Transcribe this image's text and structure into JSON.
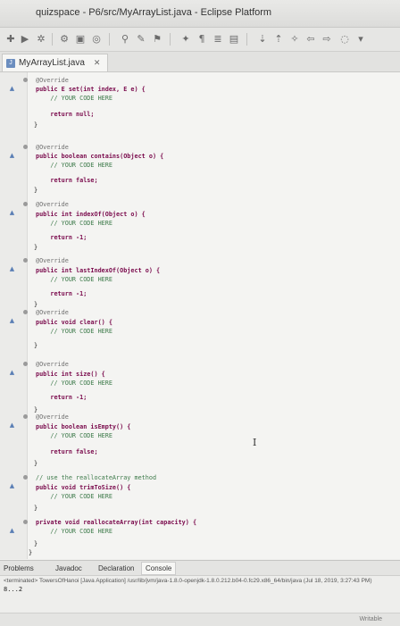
{
  "window": {
    "title": "quizspace - P6/src/MyArrayList.java - Eclipse Platform"
  },
  "toolbar": {
    "icons": [
      "new-icon",
      "run-icon",
      "debug-icon",
      "search-icon",
      "nav-icon",
      "bookmark-icon",
      "history-icon"
    ]
  },
  "editor": {
    "tab_label": "MyArrayList.java",
    "lines": [
      {
        "t": "@Override",
        "k": "ann"
      },
      {
        "t": "public E set(int index, E e) {",
        "k": "sig"
      },
      {
        "t": "    // YOUR CODE HERE",
        "k": "cm"
      },
      {
        "t": "    return null;",
        "k": "ret"
      },
      {
        "t": "}",
        "k": "br"
      },
      {
        "t": "@Override",
        "k": "ann"
      },
      {
        "t": "public boolean contains(Object o) {",
        "k": "sig"
      },
      {
        "t": "    // YOUR CODE HERE",
        "k": "cm"
      },
      {
        "t": "    return false;",
        "k": "ret"
      },
      {
        "t": "}",
        "k": "br"
      },
      {
        "t": "@Override",
        "k": "ann"
      },
      {
        "t": "public int indexOf(Object o) {",
        "k": "sig"
      },
      {
        "t": "    // YOUR CODE HERE",
        "k": "cm"
      },
      {
        "t": "    return -1;",
        "k": "ret"
      },
      {
        "t": "}",
        "k": "br"
      },
      {
        "t": "@Override",
        "k": "ann"
      },
      {
        "t": "public int lastIndexOf(Object o) {",
        "k": "sig"
      },
      {
        "t": "    // YOUR CODE HERE",
        "k": "cm"
      },
      {
        "t": "    return -1;",
        "k": "ret"
      },
      {
        "t": "}",
        "k": "br"
      },
      {
        "t": "@Override",
        "k": "ann"
      },
      {
        "t": "public void clear() {",
        "k": "sig"
      },
      {
        "t": "    // YOUR CODE HERE",
        "k": "cm"
      },
      {
        "t": "}",
        "k": "br"
      },
      {
        "t": "@Override",
        "k": "ann"
      },
      {
        "t": "public int size() {",
        "k": "sig"
      },
      {
        "t": "    // YOUR CODE HERE",
        "k": "cm"
      },
      {
        "t": "    return -1;",
        "k": "ret"
      },
      {
        "t": "}",
        "k": "br"
      },
      {
        "t": "@Override",
        "k": "ann"
      },
      {
        "t": "public boolean isEmpty() {",
        "k": "sig"
      },
      {
        "t": "    // YOUR CODE HERE",
        "k": "cm"
      },
      {
        "t": "    return false;",
        "k": "ret"
      },
      {
        "t": "}",
        "k": "br"
      },
      {
        "t": "// use the reallocateArray method",
        "k": "cm"
      },
      {
        "t": "public void trimToSize() {",
        "k": "sig"
      },
      {
        "t": "    // YOUR CODE HERE",
        "k": "cm"
      },
      {
        "t": "}",
        "k": "br"
      },
      {
        "t": "private void reallocateArray(int capacity) {",
        "k": "sig"
      },
      {
        "t": "    // YOUR CODE HERE",
        "k": "cm"
      },
      {
        "t": "}",
        "k": "br"
      },
      {
        "t": "}",
        "k": "br"
      }
    ],
    "cursor_glyph": "I"
  },
  "panel": {
    "tabs": [
      "Problems",
      "Javadoc",
      "Declaration",
      "Console"
    ],
    "console_header": "<terminated> TowersOfHanoi [Java Application] /usr/lib/jvm/java-1.8.0-openjdk-1.8.0.212.b04-0.fc29.x86_64/bin/java (Jul 18, 2019, 3:27:43 PM)",
    "console_output": "8...2",
    "status_writable": "Writable"
  }
}
